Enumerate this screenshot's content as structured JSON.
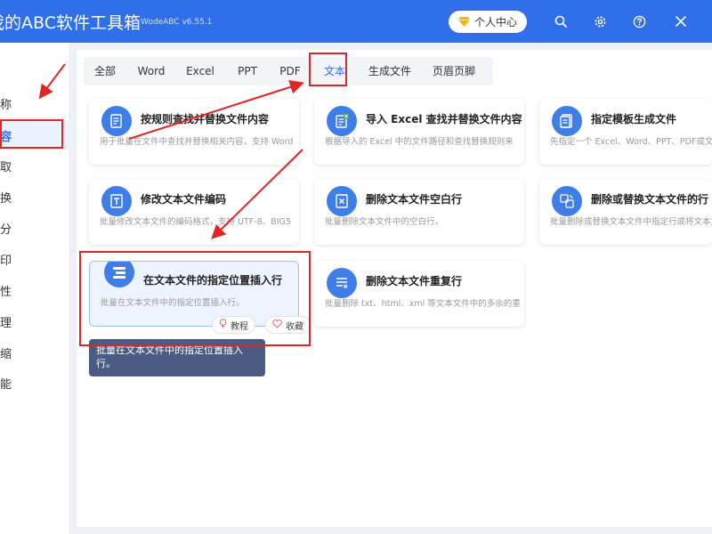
{
  "header": {
    "title": "我的ABC软件工具箱",
    "version": "WodeABC v6.55.1",
    "user_center_label": "个人中心",
    "icons": [
      "search-icon",
      "gear-icon",
      "help-icon",
      "close-icon"
    ]
  },
  "sidebar": {
    "items": [
      {
        "label": "名称",
        "active": false
      },
      {
        "label": "内容",
        "active": true
      },
      {
        "label": "提取",
        "active": false
      },
      {
        "label": "转换",
        "active": false
      },
      {
        "label": "拆分",
        "active": false
      },
      {
        "label": "打印",
        "active": false
      },
      {
        "label": "属性",
        "active": false
      },
      {
        "label": "整理",
        "active": false
      },
      {
        "label": "压缩",
        "active": false
      },
      {
        "label": "功能",
        "active": false
      }
    ]
  },
  "tabs": [
    {
      "label": "全部"
    },
    {
      "label": "Word"
    },
    {
      "label": "Excel"
    },
    {
      "label": "PPT"
    },
    {
      "label": "PDF"
    },
    {
      "label": "文本",
      "active": true
    },
    {
      "label": "生成文件"
    },
    {
      "label": "页眉页脚"
    }
  ],
  "cards": [
    {
      "title": "按规则查找并替换文件内容",
      "desc": "用于批量在文件中查找并替换相关内容，支持 Word",
      "icon": "document-edit-icon"
    },
    {
      "title": "导入 Excel 查找并替换文件内容",
      "desc": "根据导入的 Excel 中的文件路径和查找替换规则来",
      "icon": "excel-import-icon"
    },
    {
      "title": "指定模板生成文件",
      "desc": "先指定一个 Excel、Word、PPT、PDF或文本",
      "icon": "template-icon"
    },
    {
      "title": "修改文本文件编码",
      "desc": "批量修改文本文件的编码格式，支持 UTF-8、BIG5",
      "icon": "text-encoding-icon"
    },
    {
      "title": "删除文本文件空白行",
      "desc": "批量删除文本文件中的空白行。",
      "icon": "delete-blank-icon"
    },
    {
      "title": "删除或替换文本文件的行",
      "desc": "批量删除或替换文本文件中指定行或将文本文件",
      "icon": "replace-line-icon"
    },
    {
      "title": "在文本文件的指定位置插入行",
      "desc": "批量在文本文件中的指定位置插入行。",
      "icon": "insert-line-icon"
    },
    {
      "title": "删除文本文件重复行",
      "desc": "批量删除 txt、html、xml 等文本文件中的多余的重复",
      "icon": "delete-duplicate-icon"
    }
  ],
  "card_actions": {
    "tutorial_label": "教程",
    "favorite_label": "收藏"
  },
  "tooltip": {
    "text": "批量在文本文件中的指定位置插入行。"
  },
  "colors": {
    "header": "#2f6fea",
    "accent": "#2f6fea",
    "annotation": "#e02626"
  }
}
